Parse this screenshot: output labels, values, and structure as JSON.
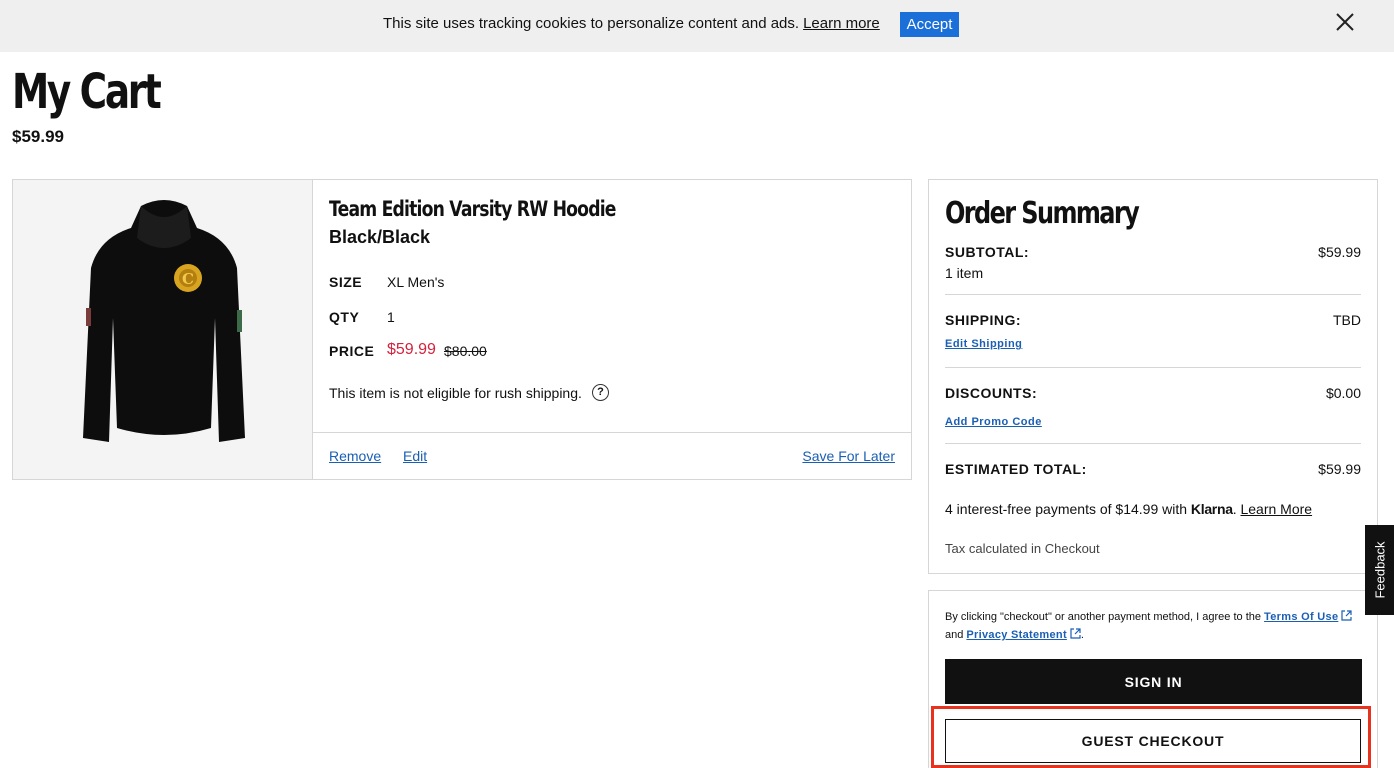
{
  "cookie_banner": {
    "text": "This site uses tracking cookies to personalize content and ads.",
    "learn_more": "Learn more",
    "accept": "Accept"
  },
  "page": {
    "title": "My Cart",
    "total": "$59.99"
  },
  "item": {
    "name": "Team Edition Varsity RW Hoodie",
    "color": "Black/Black",
    "size_label": "SIZE",
    "size_value": "XL Men's",
    "qty_label": "QTY",
    "qty_value": "1",
    "price_label": "PRICE",
    "sale_price": "$59.99",
    "original_price": "$80.00",
    "rush_note": "This item is not eligible for rush shipping.",
    "help_glyph": "?",
    "actions": {
      "remove": "Remove",
      "edit": "Edit",
      "save_for_later": "Save For Later"
    }
  },
  "summary": {
    "title": "Order Summary",
    "subtotal_label": "SUBTOTAL:",
    "subtotal_value": "$59.99",
    "item_count": "1 item",
    "shipping_label": "SHIPPING:",
    "shipping_value": "TBD",
    "edit_shipping": "Edit Shipping",
    "discounts_label": "DISCOUNTS:",
    "discounts_value": "$0.00",
    "add_promo": "Add Promo Code",
    "estimated_label": "ESTIMATED TOTAL:",
    "estimated_value": "$59.99",
    "klarna_text": "4 interest-free payments of $14.99 with",
    "klarna_brand": "Klarna",
    "klarna_period": ".",
    "klarna_learn_more": "Learn More",
    "tax_note": "Tax calculated in Checkout"
  },
  "checkout": {
    "legal_prefix": "By clicking \"checkout\" or another payment method, I agree to the",
    "terms_link": "Terms Of Use",
    "legal_and": "and",
    "privacy_link": "Privacy Statement",
    "legal_suffix": ".",
    "sign_in": "SIGN IN",
    "guest_checkout": "GUEST CHECKOUT"
  },
  "feedback": {
    "label": "Feedback"
  },
  "colors": {
    "accent_blue": "#1a6fd8",
    "link_blue": "#1a5fb4",
    "sale_red": "#d4213d",
    "highlight_red": "#e8321d"
  },
  "icons": [
    "close-icon",
    "help-icon",
    "external-link-icon",
    "hoodie-product-image"
  ]
}
